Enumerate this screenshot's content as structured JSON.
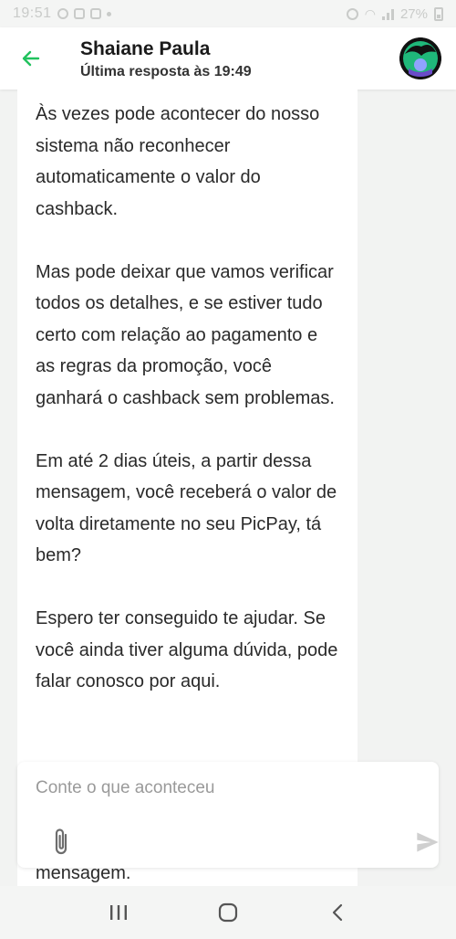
{
  "status_bar": {
    "time": "19:51",
    "battery": "27%"
  },
  "header": {
    "contact_name": "Shaiane Paula",
    "last_reply": "Última resposta às 19:49",
    "back_icon": "arrow-left-icon",
    "accent_color": "#21c25e"
  },
  "messages": [
    {
      "paragraphs": [
        "Às vezes pode acontecer do nosso sistema não reconhecer automaticamente o valor do cashback.",
        "Mas pode deixar que vamos verificar todos os detalhes, e se estiver tudo certo com relação ao pagamento e as regras da promoção, você ganhará o cashback sem problemas.",
        "Em até 2 dias úteis, a partir dessa mensagem, você receberá o valor de volta diretamente no seu PicPay, tá bem?",
        "Espero ter conseguido te ajudar. Se você ainda tiver alguma dúvida, pode falar conosco por aqui."
      ]
    }
  ],
  "trailing_text": "mensagem.",
  "composer": {
    "placeholder": "Conte o que aconteceu",
    "value": "",
    "attach_icon": "paperclip-icon",
    "send_icon": "send-icon"
  },
  "nav_bar": {
    "recents_icon": "recents-icon",
    "home_icon": "home-icon",
    "back_icon": "back-chevron-icon"
  }
}
